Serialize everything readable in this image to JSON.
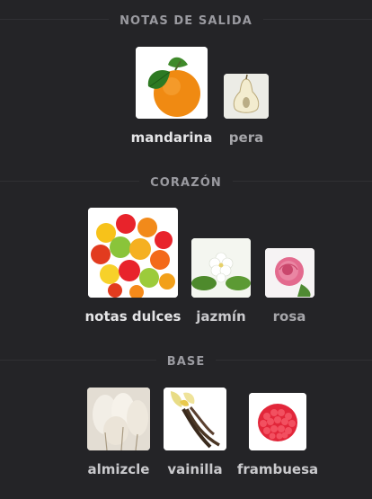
{
  "sections": [
    {
      "title": "NOTAS DE SALIDA",
      "notes": [
        {
          "label": "mandarina",
          "icon": "mandarin-icon"
        },
        {
          "label": "pera",
          "icon": "pear-icon"
        }
      ]
    },
    {
      "title": "CORAZÓN",
      "notes": [
        {
          "label": "notas dulces",
          "icon": "gummy-candies-icon"
        },
        {
          "label": "jazmín",
          "icon": "jasmine-icon"
        },
        {
          "label": "rosa",
          "icon": "rose-icon"
        }
      ]
    },
    {
      "title": "BASE",
      "notes": [
        {
          "label": "almizcle",
          "icon": "musk-icon"
        },
        {
          "label": "vainilla",
          "icon": "vanilla-icon"
        },
        {
          "label": "frambuesa",
          "icon": "raspberry-icon"
        }
      ]
    }
  ],
  "colors": {
    "background": "#242427",
    "section_title": "#9a9aa0",
    "label": "#e4e4e6"
  }
}
